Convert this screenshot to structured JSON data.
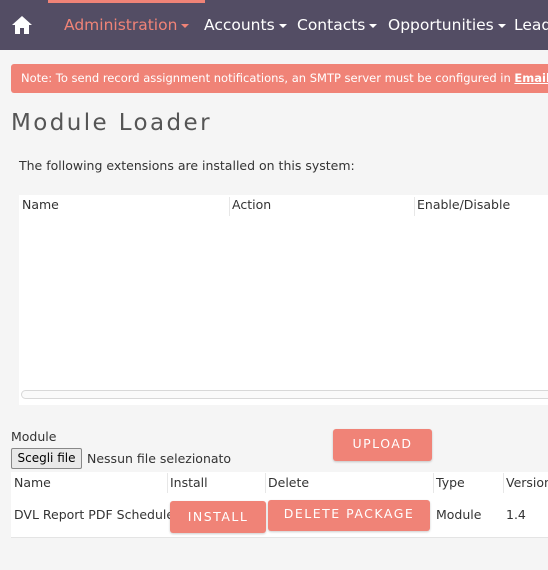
{
  "nav": {
    "home_icon": "home-icon",
    "items": [
      {
        "label": "Administration",
        "active": true
      },
      {
        "label": "Accounts"
      },
      {
        "label": "Contacts"
      },
      {
        "label": "Opportunities"
      },
      {
        "label": "Leads"
      }
    ]
  },
  "alert": {
    "text": "Note: To send record assignment notifications, an SMTP server must be configured in ",
    "link": "Email Settings",
    "suffix": "."
  },
  "page_title": "Module Loader",
  "intro": "The following extensions are installed on this system:",
  "extensions_table": {
    "columns": [
      "Name",
      "Action",
      "Enable/Disable"
    ],
    "rows": []
  },
  "upload": {
    "module_label": "Module",
    "file_button": "Scegli file",
    "file_status": "Nessun file selezionato",
    "upload_button": "Upload"
  },
  "packages_table": {
    "columns": [
      "Name",
      "Install",
      "Delete",
      "Type",
      "Version"
    ],
    "rows": [
      {
        "name": "DVL Report PDF Scheduler",
        "install": "Install",
        "delete": "Delete Package",
        "type": "Module",
        "version": "1.4"
      }
    ]
  },
  "colors": {
    "nav_bg": "#534d64",
    "accent": "#f08377",
    "page_bg": "#f5f5f5"
  }
}
